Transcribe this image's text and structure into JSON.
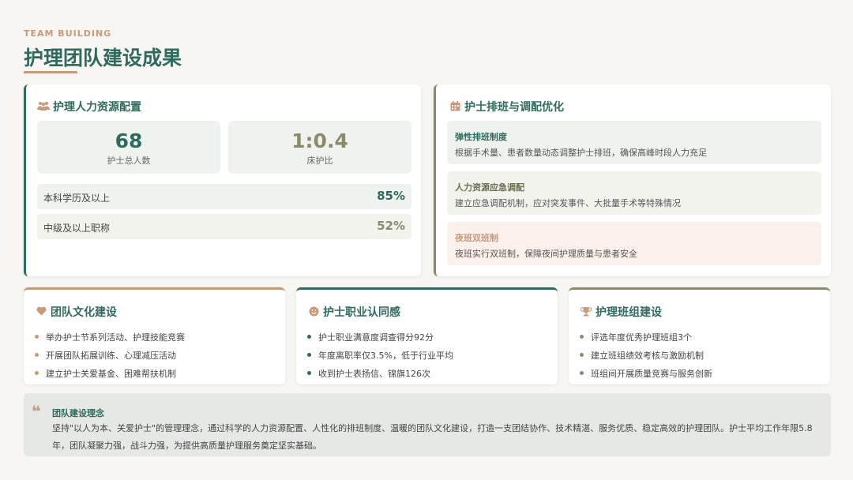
{
  "header": {
    "eyebrow": "TEAM BUILDING",
    "title": "护理团队建设成果"
  },
  "colors": {
    "primary_green": "#2e6b5e",
    "olive": "#8c8a6a",
    "accent_tan": "#c89a7a",
    "background": "#f7f6f2"
  },
  "hr_config": {
    "title": "护理人力资源配置",
    "icon": "people-icon",
    "stats": [
      {
        "value": "68",
        "label": "护士总人数"
      },
      {
        "value": "1:0.4",
        "label": "床护比"
      }
    ],
    "rows": [
      {
        "label": "本科学历及以上",
        "value": "85%"
      },
      {
        "label": "中级及以上职称",
        "value": "52%"
      }
    ]
  },
  "scheduling": {
    "title": "护士排班与调配优化",
    "icon": "calendar-icon",
    "items": [
      {
        "title": "弹性排班制度",
        "desc": "根据手术量、患者数量动态调整护士排班，确保高峰时段人力充足"
      },
      {
        "title": "人力资源应急调配",
        "desc": "建立应急调配机制，应对突发事件、大批量手术等特殊情况"
      },
      {
        "title": "夜班双班制",
        "desc": "夜班实行双班制，保障夜间护理质量与患者安全"
      }
    ]
  },
  "culture": {
    "title": "团队文化建设",
    "icon": "heart-icon",
    "bullets": [
      "举办护士节系列活动、护理技能竞赛",
      "开展团队拓展训练、心理减压活动",
      "建立护士关爱基金、困难帮扶机制"
    ]
  },
  "identity": {
    "title": "护士职业认同感",
    "icon": "smile-icon",
    "bullets": [
      "护士职业满意度调查得分92分",
      "年度离职率仅3.5%，低于行业平均",
      "收到护士表扬信、锦旗126次"
    ]
  },
  "team": {
    "title": "护理班组建设",
    "icon": "trophy-icon",
    "bullets": [
      "评选年度优秀护理班组3个",
      "建立班组绩效考核与激励机制",
      "班组间开展质量竞赛与服务创新"
    ]
  },
  "philosophy": {
    "icon": "quote-icon",
    "title": "团队建设理念",
    "body": "坚持\"以人为本、关爱护士\"的管理理念，通过科学的人力资源配置、人性化的排班制度、温暖的团队文化建设，打造一支团结协作、技术精湛、服务优质、稳定高效的护理团队。护士平均工作年限5.8年，团队凝聚力强，战斗力强，为提供高质量护理服务奠定坚实基础。"
  }
}
